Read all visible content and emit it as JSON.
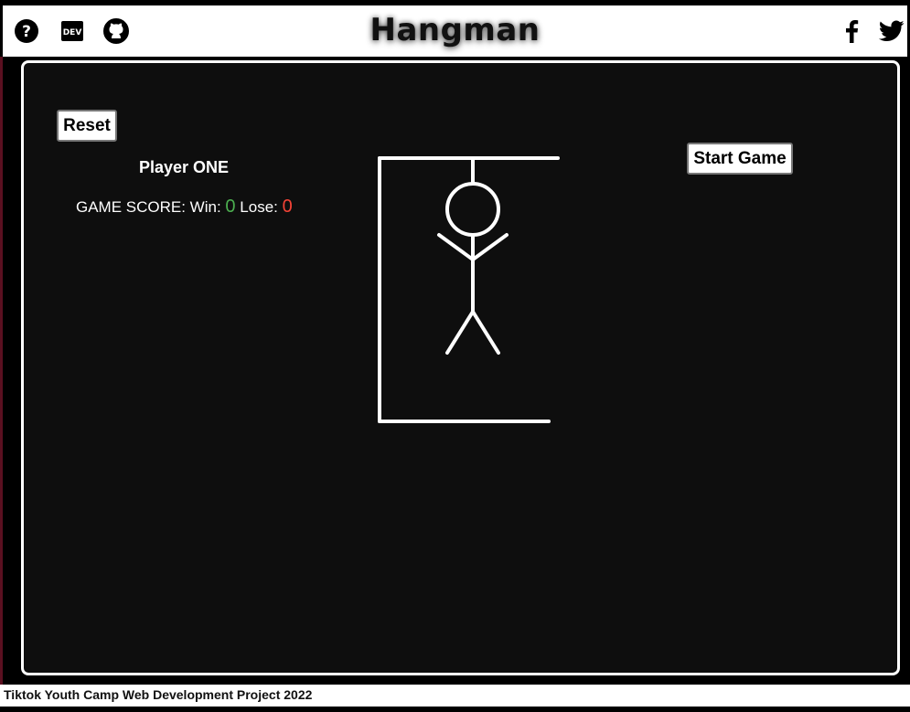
{
  "header": {
    "title": "Hangman",
    "left_icons": [
      "help-icon",
      "dev-icon",
      "github-icon"
    ],
    "dev_icon_text": "DEV",
    "right_icons": [
      "facebook-icon",
      "twitter-icon"
    ]
  },
  "game": {
    "reset_label": "Reset",
    "start_label": "Start Game",
    "player_label": "Player ONE",
    "score_prefix": "GAME SCORE: Win:",
    "win_count": "0",
    "lose_label": "Lose:",
    "lose_count": "0"
  },
  "footer": {
    "text": "Tiktok Youth Camp Web Development Project 2022"
  },
  "colors": {
    "board_bg": "#0e0e0e",
    "win": "#4caf50",
    "lose": "#f44336",
    "header_bg": "#ffffff"
  }
}
